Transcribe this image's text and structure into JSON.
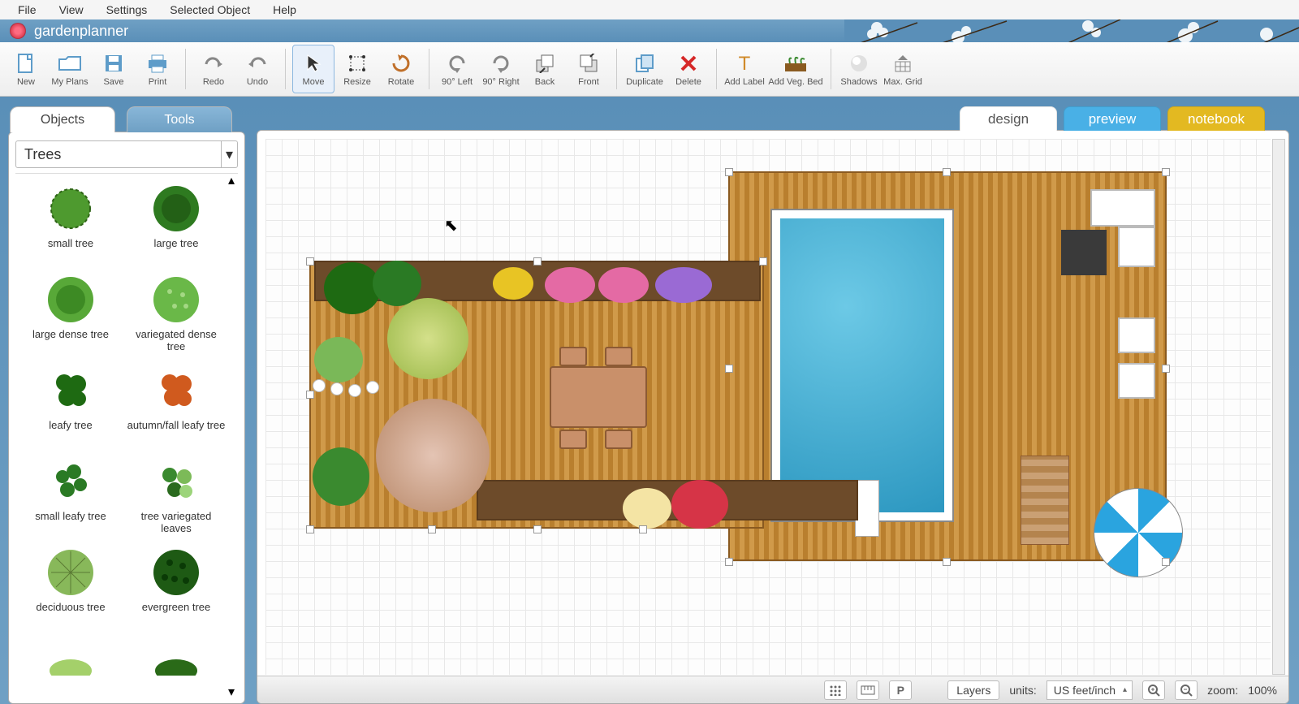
{
  "menu": {
    "items": [
      "File",
      "View",
      "Settings",
      "Selected Object",
      "Help"
    ]
  },
  "app": {
    "title": "gardenplanner"
  },
  "toolbar": {
    "new": "New",
    "myplans": "My Plans",
    "save": "Save",
    "print": "Print",
    "redo": "Redo",
    "undo": "Undo",
    "move": "Move",
    "resize": "Resize",
    "rotate": "Rotate",
    "rotleft": "90° Left",
    "rotright": "90° Right",
    "back": "Back",
    "front": "Front",
    "duplicate": "Duplicate",
    "delete": "Delete",
    "addlabel": "Add Label",
    "addvegbed": "Add Veg. Bed",
    "shadows": "Shadows",
    "maxgrid": "Max. Grid"
  },
  "sidepanel": {
    "tab_objects": "Objects",
    "tab_tools": "Tools",
    "category": "Trees",
    "items": [
      {
        "label": "small tree"
      },
      {
        "label": "large tree"
      },
      {
        "label": "large dense tree"
      },
      {
        "label": "variegated dense tree"
      },
      {
        "label": "leafy tree"
      },
      {
        "label": "autumn/fall leafy tree"
      },
      {
        "label": "small leafy tree"
      },
      {
        "label": "tree variegated leaves"
      },
      {
        "label": "deciduous tree"
      },
      {
        "label": "evergreen tree"
      }
    ]
  },
  "viewtabs": {
    "design": "design",
    "preview": "preview",
    "notebook": "notebook"
  },
  "footer": {
    "layers": "Layers",
    "units_label": "units:",
    "units_value": "US feet/inch",
    "zoom_label": "zoom:",
    "zoom_value": "100%"
  }
}
